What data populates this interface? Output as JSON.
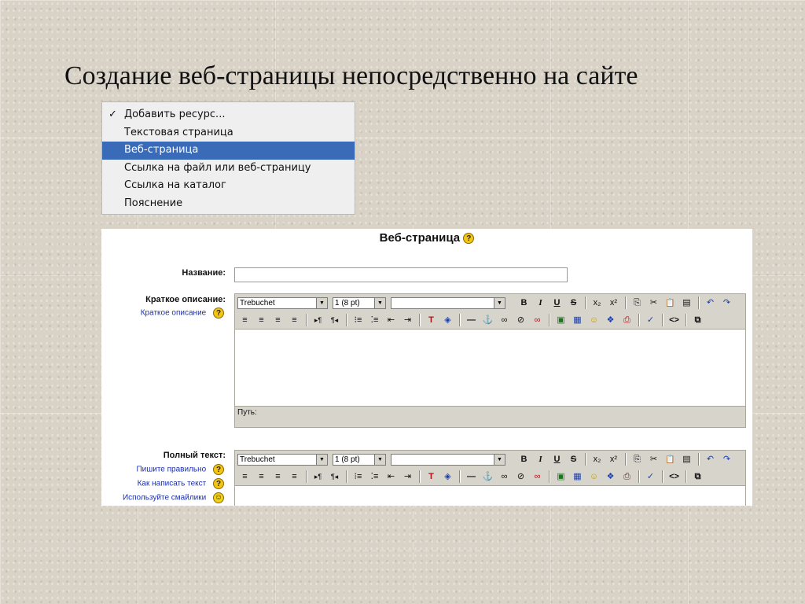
{
  "slide_title": "Создание веб-страницы непосредственно на сайте",
  "menu": {
    "items": [
      {
        "label": "Добавить ресурс...",
        "checked": true
      },
      {
        "label": "Текстовая страница"
      },
      {
        "label": "Веб-страница",
        "selected": true
      },
      {
        "label": "Ссылка на файл или веб-страницу"
      },
      {
        "label": "Ссылка на каталог"
      },
      {
        "label": "Пояснение"
      }
    ],
    "check_glyph": "✓",
    "highlight_color": "#3a6bb8"
  },
  "form": {
    "title": "Веб-страница",
    "help_glyph": "?",
    "name_label": "Название:",
    "name_value": "",
    "summary_label": "Краткое описание:",
    "summary_help_link": "Краткое описание",
    "fulltext_label": "Полный текст:",
    "fulltext_links": [
      "Пишите правильно",
      "Как написать текст",
      "Используйте смайлики"
    ],
    "path_label": "Путь:"
  },
  "toolbar": {
    "font": "Trebuchet",
    "size": "1 (8 pt)",
    "style": "",
    "bold": "B",
    "italic": "I",
    "underline": "U",
    "strike": "S",
    "subscript": "x₂",
    "superscript": "x²",
    "copy": "⎘",
    "cut": "✂",
    "paste": "📋",
    "paste_word": "▤",
    "undo": "↶",
    "redo": "↷",
    "align_left": "≡",
    "align_center": "≡",
    "align_right": "≡",
    "justify": "≡",
    "ltr": "▸¶",
    "rtl": "¶◂",
    "ordered_list": "⁝≡",
    "unordered_list": "⁚≡",
    "outdent": "⇤",
    "indent": "⇥",
    "text_color": "T",
    "bg_color": "◈",
    "hr": "—",
    "anchor": "⚓",
    "link": "∞",
    "unlink": "⊘",
    "nolink": "∞",
    "image": "▣",
    "table": "▦",
    "smiley": "☺",
    "insert_char": "❖",
    "search": "⎙",
    "spellcheck": "✓",
    "html_mode": "<>",
    "fullscreen": "⧉"
  },
  "icons": {
    "help": "help-icon",
    "smiley": "smiley-icon"
  }
}
